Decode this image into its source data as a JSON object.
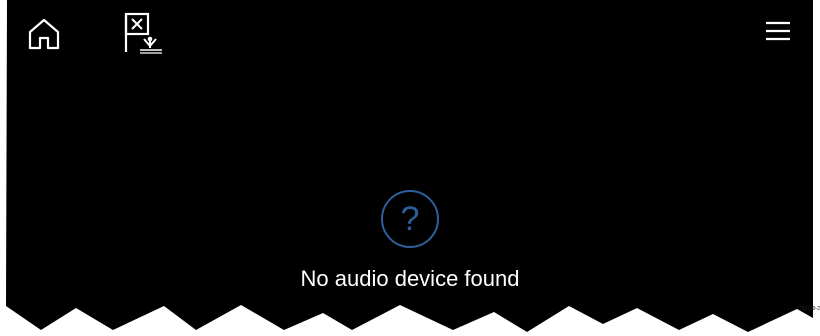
{
  "icons": {
    "home": "home-icon",
    "man_overboard": "man-overboard-icon",
    "menu": "hamburger-menu-icon",
    "help": "question-mark-icon"
  },
  "status": {
    "help_symbol": "?",
    "message": "No audio device found"
  },
  "figure_id": "D13739-2",
  "colors": {
    "screen_background": "#000000",
    "page_background": "#ffffff",
    "icon_color": "#ffffff",
    "help_accent": "#2d5f9b",
    "message_text": "#ffffff"
  }
}
